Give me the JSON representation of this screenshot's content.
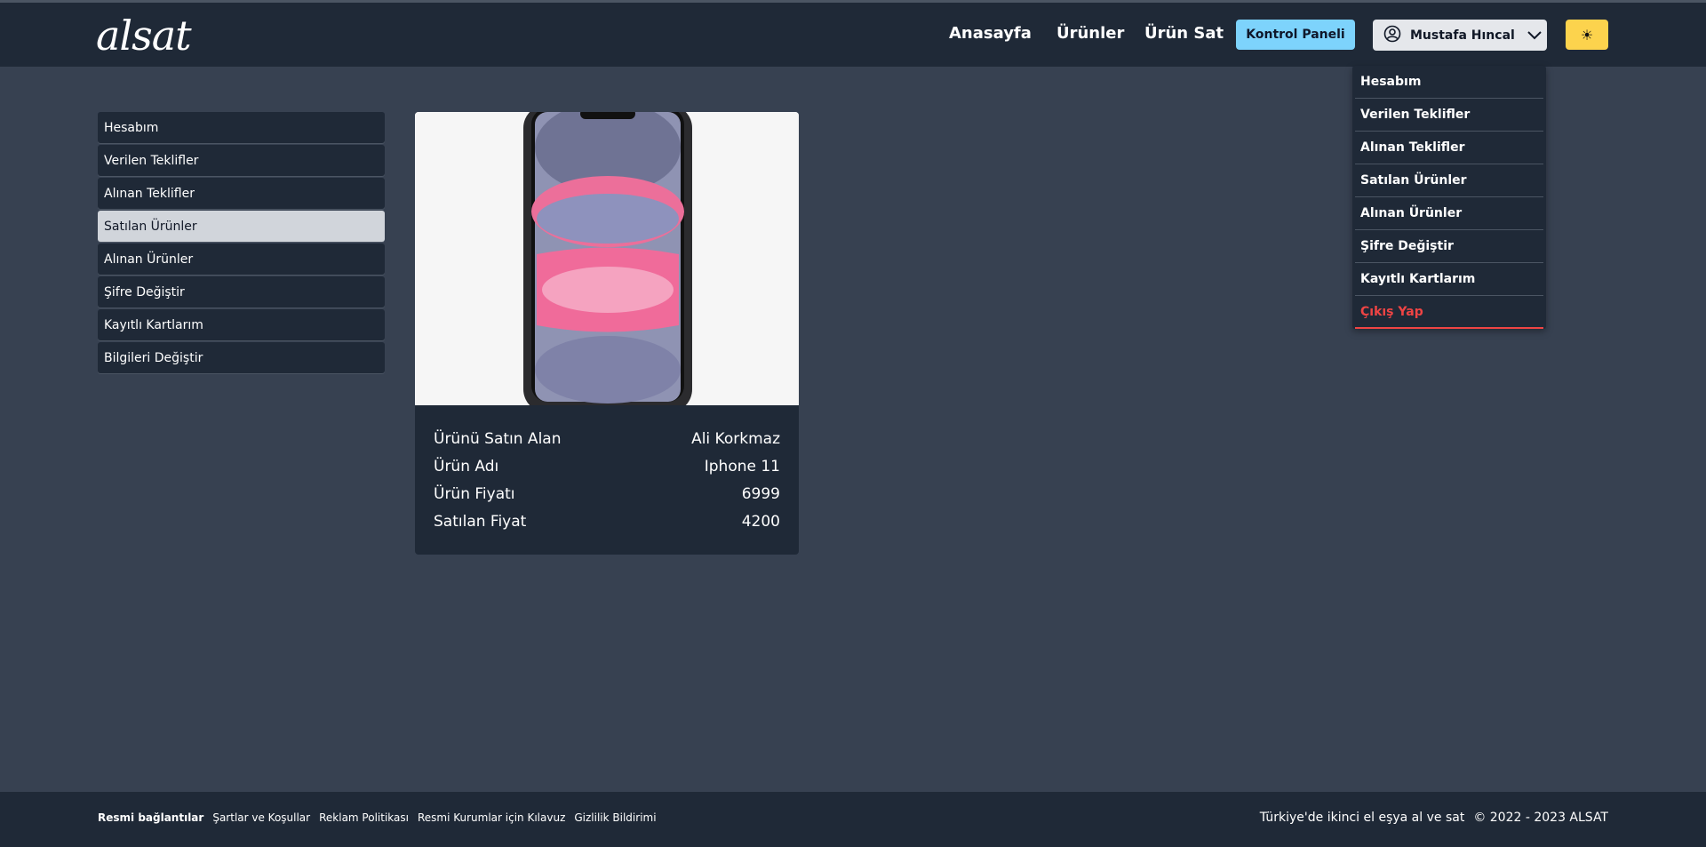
{
  "header": {
    "logo": "alsat",
    "nav": [
      "Anasayfa",
      "Ürünler",
      "Ürün Sat"
    ],
    "panel_label": "Kontrol Paneli",
    "user_name": "Mustafa Hıncal",
    "theme_icon": "☀"
  },
  "colors": {
    "page_bg": "#374151",
    "panel_bg": "#1f2937",
    "accent_blue": "#7dd3fc",
    "accent_yellow": "#fcd34d",
    "danger": "#ef4444"
  },
  "sidebar": {
    "items": [
      {
        "label": "Hesabım"
      },
      {
        "label": "Verilen Teklifler"
      },
      {
        "label": "Alınan Teklifler"
      },
      {
        "label": "Satılan Ürünler"
      },
      {
        "label": "Alınan Ürünler"
      },
      {
        "label": "Şifre Değiştir"
      },
      {
        "label": "Kayıtlı Kartlarım"
      },
      {
        "label": "Bilgileri Değiştir"
      }
    ],
    "active": "Satılan Ürünler"
  },
  "card": {
    "image": "iphone-11-product-image",
    "rows": [
      {
        "label": "Ürünü Satın Alan",
        "value": "Ali Korkmaz"
      },
      {
        "label": "Ürün Adı",
        "value": "Iphone 11"
      },
      {
        "label": "Ürün Fiyatı",
        "value": "6999"
      },
      {
        "label": "Satılan Fiyat",
        "value": "4200"
      }
    ]
  },
  "dropdown": {
    "items": [
      {
        "label": "Hesabım"
      },
      {
        "label": "Verilen Teklifler"
      },
      {
        "label": "Alınan Teklifler"
      },
      {
        "label": "Satılan Ürünler"
      },
      {
        "label": "Alınan Ürünler"
      },
      {
        "label": "Şifre Değiştir"
      },
      {
        "label": "Kayıtlı Kartlarım"
      },
      {
        "label": "Çıkış Yap"
      }
    ]
  },
  "footer": {
    "links_title": "Resmi bağlantılar",
    "links": [
      "Şartlar ve Koşullar",
      "Reklam Politikası",
      "Resmi Kurumlar için Kılavuz",
      "Gizlilik Bildirimi"
    ],
    "tagline": "Türkiye'de ikinci el eşya al ve sat",
    "copyright": "© 2022 - 2023 ALSAT"
  }
}
